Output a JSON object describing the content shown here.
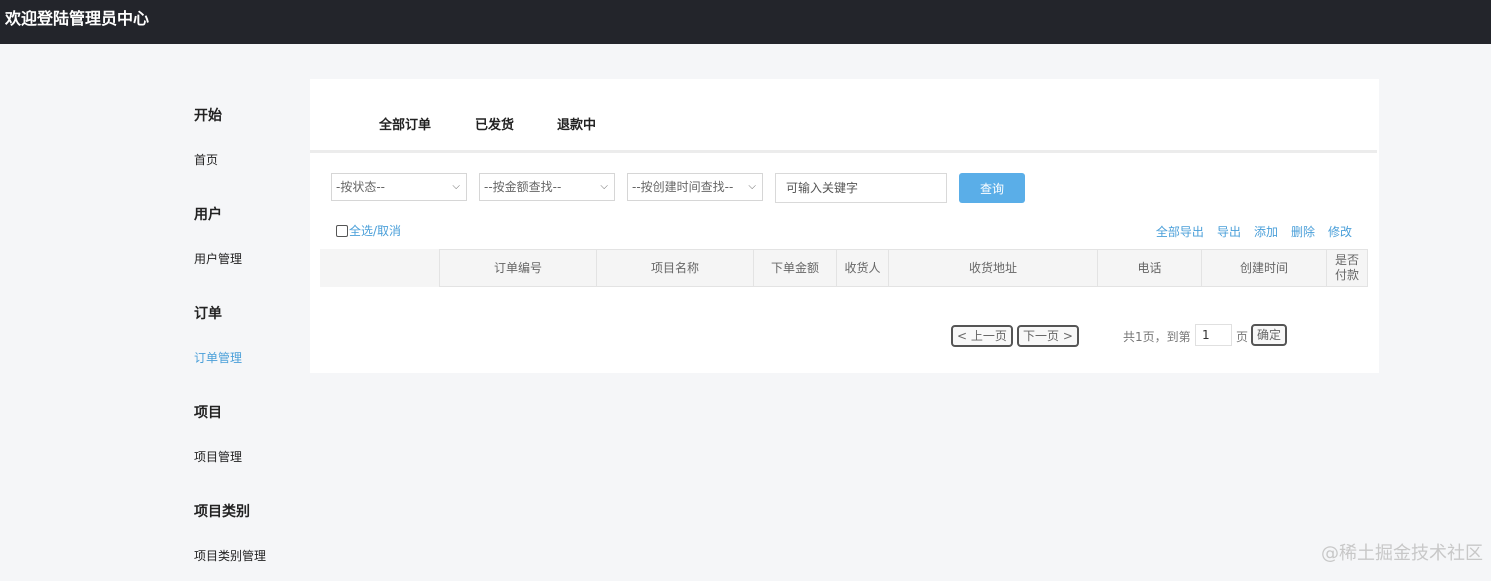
{
  "header": {
    "title": "欢迎登陆管理员中心"
  },
  "sidebar": {
    "groups": [
      {
        "title": "开始",
        "items": [
          {
            "label": "首页"
          }
        ]
      },
      {
        "title": "用户",
        "items": [
          {
            "label": "用户管理"
          }
        ]
      },
      {
        "title": "订单",
        "items": [
          {
            "label": "订单管理"
          }
        ]
      },
      {
        "title": "项目",
        "items": [
          {
            "label": "项目管理"
          }
        ]
      },
      {
        "title": "项目类别",
        "items": [
          {
            "label": "项目类别管理"
          }
        ]
      }
    ],
    "active_color": "#4a9fd9"
  },
  "tabs": [
    {
      "label": "全部订单"
    },
    {
      "label": "已发货"
    },
    {
      "label": "退款中"
    }
  ],
  "filters": {
    "status_select": "-按状态--",
    "amount_select": "--按金额查找--",
    "time_select": "--按创建时间查找--",
    "keyword_placeholder": "可输入关键字",
    "query_label": "查询",
    "query_color": "#5aaee8"
  },
  "toolbar": {
    "select_all_label": "全选/取消",
    "export_all": "全部导出",
    "export": "导出",
    "add": "添加",
    "delete": "删除",
    "edit": "修改"
  },
  "table": {
    "columns": [
      "",
      "订单编号",
      "项目名称",
      "下单金额",
      "收货人",
      "收货地址",
      "电话",
      "创建时间",
      "是否付款"
    ]
  },
  "pagination": {
    "prev_label": "< 上一页",
    "next_label": "下一页 >",
    "total_text": "共1页，到第",
    "page_value": "1",
    "page_suffix": "页",
    "confirm_label": "确定"
  },
  "watermark": "@稀土掘金技术社区"
}
